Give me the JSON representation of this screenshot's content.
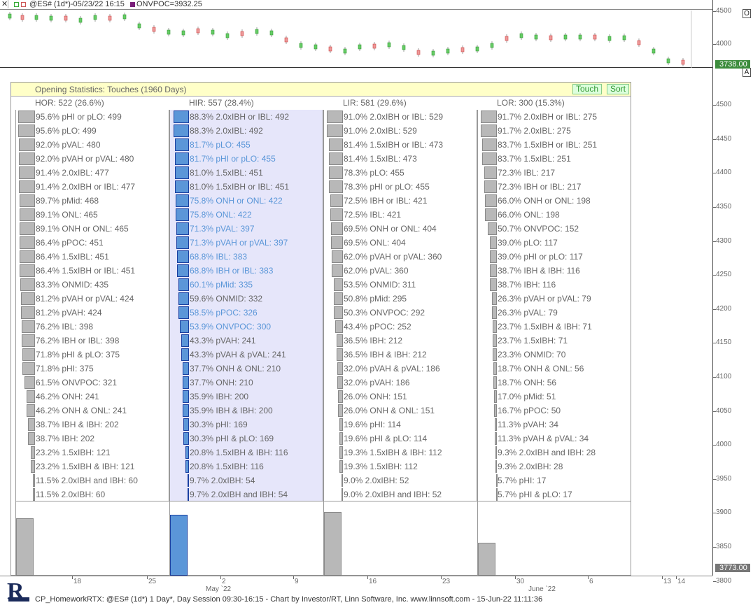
{
  "titlebar": {
    "symbol_text": "@ES# (1d*)-05/23/22 16:15",
    "indicator_text": "ONVPOC=3932.25"
  },
  "price_axis": {
    "ticks": [
      "4500",
      "4450",
      "4400",
      "4350",
      "4300",
      "4250",
      "4200",
      "4150",
      "4100",
      "4050",
      "4000",
      "3950",
      "3900",
      "3850",
      "3800"
    ],
    "top_ticks": [
      "4500",
      "4000"
    ],
    "last_price": "3738.00",
    "bottom_price": "3773.00",
    "btn_o": "O",
    "btn_a": "A"
  },
  "panel": {
    "title": "Opening Statistics: Touches (1960 Days)",
    "touch_label": "Touch",
    "sort_label": "Sort"
  },
  "columns": [
    {
      "header": "HOR: 522 (26.6%)",
      "highlight": false,
      "rows": [
        {
          "text": "95.6%  pHI or pLO: 499",
          "pct": 95.6
        },
        {
          "text": "95.6%  pLO: 499",
          "pct": 95.6
        },
        {
          "text": "92.0%  pVAL: 480",
          "pct": 92.0
        },
        {
          "text": "92.0%  pVAH or pVAL: 480",
          "pct": 92.0
        },
        {
          "text": "91.4%  2.0xIBL: 477",
          "pct": 91.4
        },
        {
          "text": "91.4%  2.0xIBH or IBL: 477",
          "pct": 91.4
        },
        {
          "text": "89.7%  pMid: 468",
          "pct": 89.7
        },
        {
          "text": "89.1%  ONL: 465",
          "pct": 89.1
        },
        {
          "text": "89.1%  ONH or ONL: 465",
          "pct": 89.1
        },
        {
          "text": "86.4%  pPOC: 451",
          "pct": 86.4
        },
        {
          "text": "86.4%  1.5xIBL: 451",
          "pct": 86.4
        },
        {
          "text": "86.4%  1.5xIBH or IBL: 451",
          "pct": 86.4
        },
        {
          "text": "83.3%  ONMID: 435",
          "pct": 83.3
        },
        {
          "text": "81.2%  pVAH or pVAL: 424",
          "pct": 81.2
        },
        {
          "text": "81.2%  pVAH: 424",
          "pct": 81.2
        },
        {
          "text": "76.2%  IBL: 398",
          "pct": 76.2
        },
        {
          "text": "76.2%  IBH or IBL: 398",
          "pct": 76.2
        },
        {
          "text": "71.8%  pHI & pLO: 375",
          "pct": 71.8
        },
        {
          "text": "71.8%  pHI: 375",
          "pct": 71.8
        },
        {
          "text": "61.5%  ONVPOC: 321",
          "pct": 61.5
        },
        {
          "text": "46.2%  ONH: 241",
          "pct": 46.2
        },
        {
          "text": "46.2%  ONH & ONL: 241",
          "pct": 46.2
        },
        {
          "text": "38.7%  IBH & IBH: 202",
          "pct": 38.7
        },
        {
          "text": "38.7%  IBH: 202",
          "pct": 38.7
        },
        {
          "text": "23.2%  1.5xIBH: 121",
          "pct": 23.2
        },
        {
          "text": "23.2%  1.5xIBH & IBH: 121",
          "pct": 23.2
        },
        {
          "text": "11.5%  2.0xIBH and IBH: 60",
          "pct": 11.5
        },
        {
          "text": "11.5%  2.0xIBH: 60",
          "pct": 11.5
        }
      ],
      "low_bar_pct": 26.6
    },
    {
      "header": "HIR: 557 (28.4%)",
      "highlight": true,
      "rows": [
        {
          "text": "88.3%  2.0xIBH or IBL: 492",
          "pct": 88.3,
          "blue": false
        },
        {
          "text": "88.3%  2.0xIBL: 492",
          "pct": 88.3,
          "blue": false
        },
        {
          "text": "81.7%  pLO: 455",
          "pct": 81.7,
          "blue": true
        },
        {
          "text": "81.7%  pHI or pLO: 455",
          "pct": 81.7,
          "blue": true
        },
        {
          "text": "81.0%  1.5xIBL: 451",
          "pct": 81.0,
          "blue": false
        },
        {
          "text": "81.0%  1.5xIBH or IBL: 451",
          "pct": 81.0,
          "blue": false
        },
        {
          "text": "75.8%  ONH or ONL: 422",
          "pct": 75.8,
          "blue": true
        },
        {
          "text": "75.8%  ONL: 422",
          "pct": 75.8,
          "blue": true
        },
        {
          "text": "71.3%  pVAL: 397",
          "pct": 71.3,
          "blue": true
        },
        {
          "text": "71.3%  pVAH or pVAL: 397",
          "pct": 71.3,
          "blue": true
        },
        {
          "text": "68.8%  IBL: 383",
          "pct": 68.8,
          "blue": true
        },
        {
          "text": "68.8%  IBH or IBL: 383",
          "pct": 68.8,
          "blue": true
        },
        {
          "text": "60.1%  pMid: 335",
          "pct": 60.1,
          "blue": true
        },
        {
          "text": "59.6%  ONMID: 332",
          "pct": 59.6,
          "blue": false
        },
        {
          "text": "58.5%  pPOC: 326",
          "pct": 58.5,
          "blue": true
        },
        {
          "text": "53.9%  ONVPOC: 300",
          "pct": 53.9,
          "blue": true
        },
        {
          "text": "43.3%  pVAH: 241",
          "pct": 43.3,
          "blue": false
        },
        {
          "text": "43.3%  pVAH & pVAL: 241",
          "pct": 43.3,
          "blue": false
        },
        {
          "text": "37.7%  ONH & ONL: 210",
          "pct": 37.7,
          "blue": false
        },
        {
          "text": "37.7%  ONH: 210",
          "pct": 37.7,
          "blue": false
        },
        {
          "text": "35.9%  IBH: 200",
          "pct": 35.9,
          "blue": false
        },
        {
          "text": "35.9%  IBH & IBH: 200",
          "pct": 35.9,
          "blue": false
        },
        {
          "text": "30.3%  pHI: 169",
          "pct": 30.3,
          "blue": false
        },
        {
          "text": "30.3%  pHI & pLO: 169",
          "pct": 30.3,
          "blue": false
        },
        {
          "text": "20.8%  1.5xIBH & IBH: 116",
          "pct": 20.8,
          "blue": false
        },
        {
          "text": "20.8%  1.5xIBH: 116",
          "pct": 20.8,
          "blue": false
        },
        {
          "text": "9.7%  2.0xIBH: 54",
          "pct": 9.7,
          "blue": false
        },
        {
          "text": "9.7%  2.0xIBH and IBH: 54",
          "pct": 9.7,
          "blue": false
        }
      ],
      "low_bar_pct": 28.4
    },
    {
      "header": "LIR: 581 (29.6%)",
      "highlight": false,
      "rows": [
        {
          "text": "91.0%  2.0xIBH or IBL: 529",
          "pct": 91.0
        },
        {
          "text": "91.0%  2.0xIBL: 529",
          "pct": 91.0
        },
        {
          "text": "81.4%  1.5xIBH or IBL: 473",
          "pct": 81.4
        },
        {
          "text": "81.4%  1.5xIBL: 473",
          "pct": 81.4
        },
        {
          "text": "78.3%  pLO: 455",
          "pct": 78.3
        },
        {
          "text": "78.3%  pHI or pLO: 455",
          "pct": 78.3
        },
        {
          "text": "72.5%  IBH or IBL: 421",
          "pct": 72.5
        },
        {
          "text": "72.5%  IBL: 421",
          "pct": 72.5
        },
        {
          "text": "69.5%  ONH or ONL: 404",
          "pct": 69.5
        },
        {
          "text": "69.5%  ONL: 404",
          "pct": 69.5
        },
        {
          "text": "62.0%  pVAH or pVAL: 360",
          "pct": 62.0
        },
        {
          "text": "62.0%  pVAL: 360",
          "pct": 62.0
        },
        {
          "text": "53.5%  ONMID: 311",
          "pct": 53.5
        },
        {
          "text": "50.8%  pMid: 295",
          "pct": 50.8
        },
        {
          "text": "50.3%  ONVPOC: 292",
          "pct": 50.3
        },
        {
          "text": "43.4%  pPOC: 252",
          "pct": 43.4
        },
        {
          "text": "36.5%  IBH: 212",
          "pct": 36.5
        },
        {
          "text": "36.5%  IBH & IBH: 212",
          "pct": 36.5
        },
        {
          "text": "32.0%  pVAH & pVAL: 186",
          "pct": 32.0
        },
        {
          "text": "32.0%  pVAH: 186",
          "pct": 32.0
        },
        {
          "text": "26.0%  ONH: 151",
          "pct": 26.0
        },
        {
          "text": "26.0%  ONH & ONL: 151",
          "pct": 26.0
        },
        {
          "text": "19.6%  pHI: 114",
          "pct": 19.6
        },
        {
          "text": "19.6%  pHI & pLO: 114",
          "pct": 19.6
        },
        {
          "text": "19.3%  1.5xIBH & IBH: 112",
          "pct": 19.3
        },
        {
          "text": "19.3%  1.5xIBH: 112",
          "pct": 19.3
        },
        {
          "text": "9.0%  2.0xIBH: 52",
          "pct": 9.0
        },
        {
          "text": "9.0%  2.0xIBH and IBH: 52",
          "pct": 9.0
        }
      ],
      "low_bar_pct": 29.6
    },
    {
      "header": "LOR: 300 (15.3%)",
      "highlight": false,
      "rows": [
        {
          "text": "91.7%  2.0xIBH or IBL: 275",
          "pct": 91.7
        },
        {
          "text": "91.7%  2.0xIBL: 275",
          "pct": 91.7
        },
        {
          "text": "83.7%  1.5xIBH or IBL: 251",
          "pct": 83.7
        },
        {
          "text": "83.7%  1.5xIBL: 251",
          "pct": 83.7
        },
        {
          "text": "72.3%  IBL: 217",
          "pct": 72.3
        },
        {
          "text": "72.3%  IBH or IBL: 217",
          "pct": 72.3
        },
        {
          "text": "66.0%  ONH or ONL: 198",
          "pct": 66.0
        },
        {
          "text": "66.0%  ONL: 198",
          "pct": 66.0
        },
        {
          "text": "50.7%  ONVPOC: 152",
          "pct": 50.7
        },
        {
          "text": "39.0%  pLO: 117",
          "pct": 39.0
        },
        {
          "text": "39.0%  pHI or pLO: 117",
          "pct": 39.0
        },
        {
          "text": "38.7%  IBH & IBH: 116",
          "pct": 38.7
        },
        {
          "text": "38.7%  IBH: 116",
          "pct": 38.7
        },
        {
          "text": "26.3%  pVAH or pVAL: 79",
          "pct": 26.3
        },
        {
          "text": "26.3%  pVAL: 79",
          "pct": 26.3
        },
        {
          "text": "23.7%  1.5xIBH & IBH: 71",
          "pct": 23.7
        },
        {
          "text": "23.7%  1.5xIBH: 71",
          "pct": 23.7
        },
        {
          "text": "23.3%  ONMID: 70",
          "pct": 23.3
        },
        {
          "text": "18.7%  ONH & ONL: 56",
          "pct": 18.7
        },
        {
          "text": "18.7%  ONH: 56",
          "pct": 18.7
        },
        {
          "text": "17.0%  pMid: 51",
          "pct": 17.0
        },
        {
          "text": "16.7%  pPOC: 50",
          "pct": 16.7
        },
        {
          "text": "11.3%  pVAH: 34",
          "pct": 11.3
        },
        {
          "text": "11.3%  pVAH & pVAL: 34",
          "pct": 11.3
        },
        {
          "text": "9.3%  2.0xIBH and IBH: 28",
          "pct": 9.3
        },
        {
          "text": "9.3%  2.0xIBH: 28",
          "pct": 9.3
        },
        {
          "text": "5.7%  pHI: 17",
          "pct": 5.7
        },
        {
          "text": "5.7%  pHI & pLO: 17",
          "pct": 5.7
        }
      ],
      "low_bar_pct": 15.3
    }
  ],
  "dates": [
    "18",
    "25",
    "2",
    "9",
    "16",
    "23",
    "30",
    "6",
    "13",
    "14"
  ],
  "months": [
    "May `22",
    "June `22"
  ],
  "statusbar": {
    "text": "CP_HomeworkRTX: @ES# (1d*) 1 Day*, Day Session 09:30-16:15 - Chart by Investor/RT, Linn Software, Inc. www.linnsoft.com - 15-Jun-22 11:11:36"
  },
  "colors": {
    "accent_blue": "#5b96d8",
    "panel_header": "#ffffc8",
    "highlight_bg": "#e6e6fa",
    "price_box": "#3c8c3c"
  }
}
